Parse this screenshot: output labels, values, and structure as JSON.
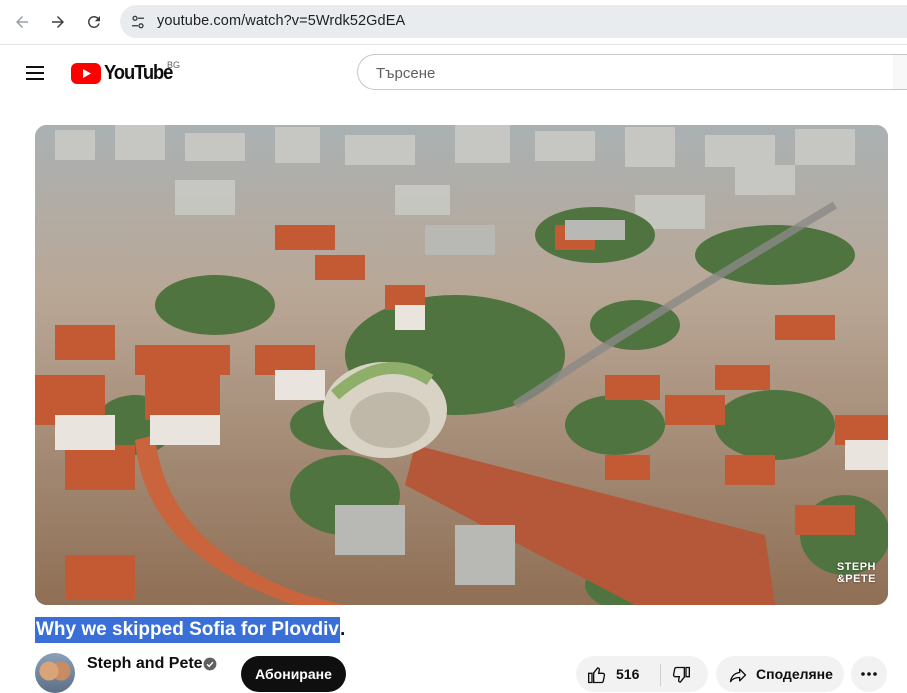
{
  "browser": {
    "url": "youtube.com/watch?v=5Wrdk52GdEA",
    "icons": {
      "back": "arrow-left-icon",
      "forward": "arrow-right-icon",
      "reload": "reload-icon",
      "site_info": "tune-icon"
    }
  },
  "header": {
    "logo_text": "YouTube",
    "country_code": "BG",
    "search_placeholder": "Търсене",
    "icons": {
      "menu": "hamburger-menu-icon",
      "logo": "youtube-play-icon"
    }
  },
  "video": {
    "watermark_line1": "STEPH",
    "watermark_line2": "&PETE",
    "title_selected": "Why we skipped Sofia for Plovdiv",
    "title_rest": "."
  },
  "owner": {
    "channel_name": "Steph and Pete",
    "subscribe_label": "Абониране",
    "icons": {
      "verified": "verified-check-icon"
    }
  },
  "actions": {
    "like_count": "516",
    "share_label": "Споделяне",
    "icons": {
      "like": "thumbs-up-icon",
      "dislike": "thumbs-down-icon",
      "share": "share-arrow-icon",
      "more": "more-horizontal-icon"
    }
  },
  "colors": {
    "brand_red": "#ff0000",
    "selection_blue": "#3a6fd8",
    "button_dark": "#0f0f0f",
    "button_light": "#f2f2f2"
  }
}
